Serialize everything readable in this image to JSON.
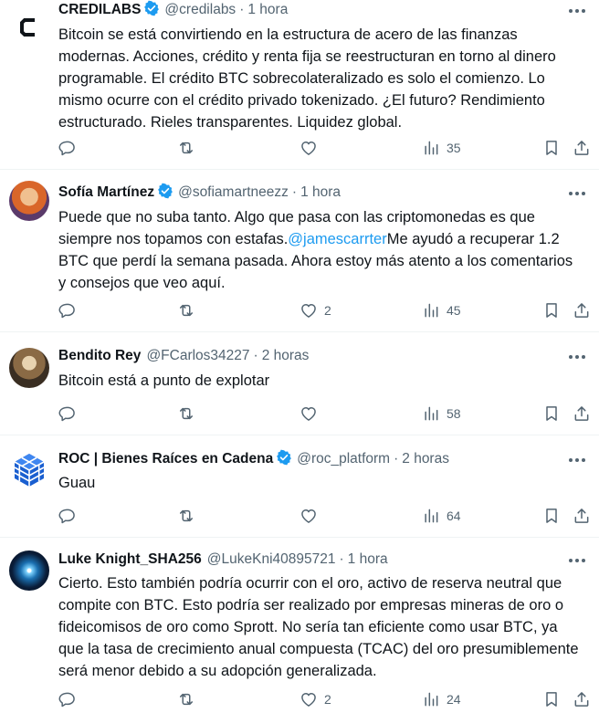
{
  "tweets": [
    {
      "name": "CREDILABS",
      "handle": "@credilabs",
      "sep": "·",
      "time": "1 hora",
      "text_before": "Bitcoin se está convirtiendo en la estructura de acero de las finanzas modernas. Acciones, crédito y renta fija se reestructuran en torno al dinero programable. El crédito BTC sobrecolateralizado es solo el comienzo. Lo mismo ocurre con el crédito privado tokenizado. ¿El futuro? Rendimiento estructurado. Rieles transparentes. Liquidez global.",
      "mention": "",
      "text_after": "",
      "replies": "",
      "retweets": "",
      "likes": "",
      "views": "35"
    },
    {
      "name": "Sofía Martínez",
      "handle": "@sofiamartneezz",
      "sep": "·",
      "time": "1 hora",
      "text_before": "Puede que no suba tanto. Algo que pasa con las criptomonedas es que siempre nos topamos con estafas.",
      "mention": "@jamescarrter",
      "text_after": "Me ayudó a recuperar 1.2 BTC que perdí la semana pasada. Ahora estoy más atento a los comentarios y consejos que veo aquí.",
      "replies": "",
      "retweets": "",
      "likes": "2",
      "views": "45"
    },
    {
      "name": "Bendito Rey",
      "handle": "@FCarlos34227",
      "sep": "·",
      "time": "2 horas",
      "text_before": "Bitcoin está a punto de explotar",
      "mention": "",
      "text_after": "",
      "replies": "",
      "retweets": "",
      "likes": "",
      "views": "58"
    },
    {
      "name": "ROC | Bienes Raíces en Cadena",
      "handle": "@roc_platform",
      "sep": "·",
      "time": "2 horas",
      "text_before": "Guau",
      "mention": "",
      "text_after": "",
      "replies": "",
      "retweets": "",
      "likes": "",
      "views": "64"
    },
    {
      "name": "Luke Knight_SHA256",
      "handle": "@LukeKni40895721",
      "sep": "·",
      "time": "1 hora",
      "text_before": "Cierto. Esto también podría ocurrir con el oro, activo de reserva neutral que compite con BTC. Esto podría ser realizado por empresas mineras de oro o fideicomisos de oro como Sprott. No sería tan eficiente como usar BTC, ya que la tasa de crecimiento anual compuesta (TCAC) del oro presumiblemente será menor debido a su adopción generalizada.",
      "mention": "",
      "text_after": "",
      "replies": "",
      "retweets": "",
      "likes": "2",
      "views": "24"
    }
  ],
  "colors": {
    "accent": "#1d9bf0",
    "text": "#0f1419",
    "secondary": "#536471",
    "divider": "#eff3f4"
  },
  "icons": [
    "verified-badge-icon",
    "more-options-icon",
    "reply-icon",
    "retweet-icon",
    "like-icon",
    "views-icon",
    "bookmark-icon",
    "share-icon"
  ]
}
